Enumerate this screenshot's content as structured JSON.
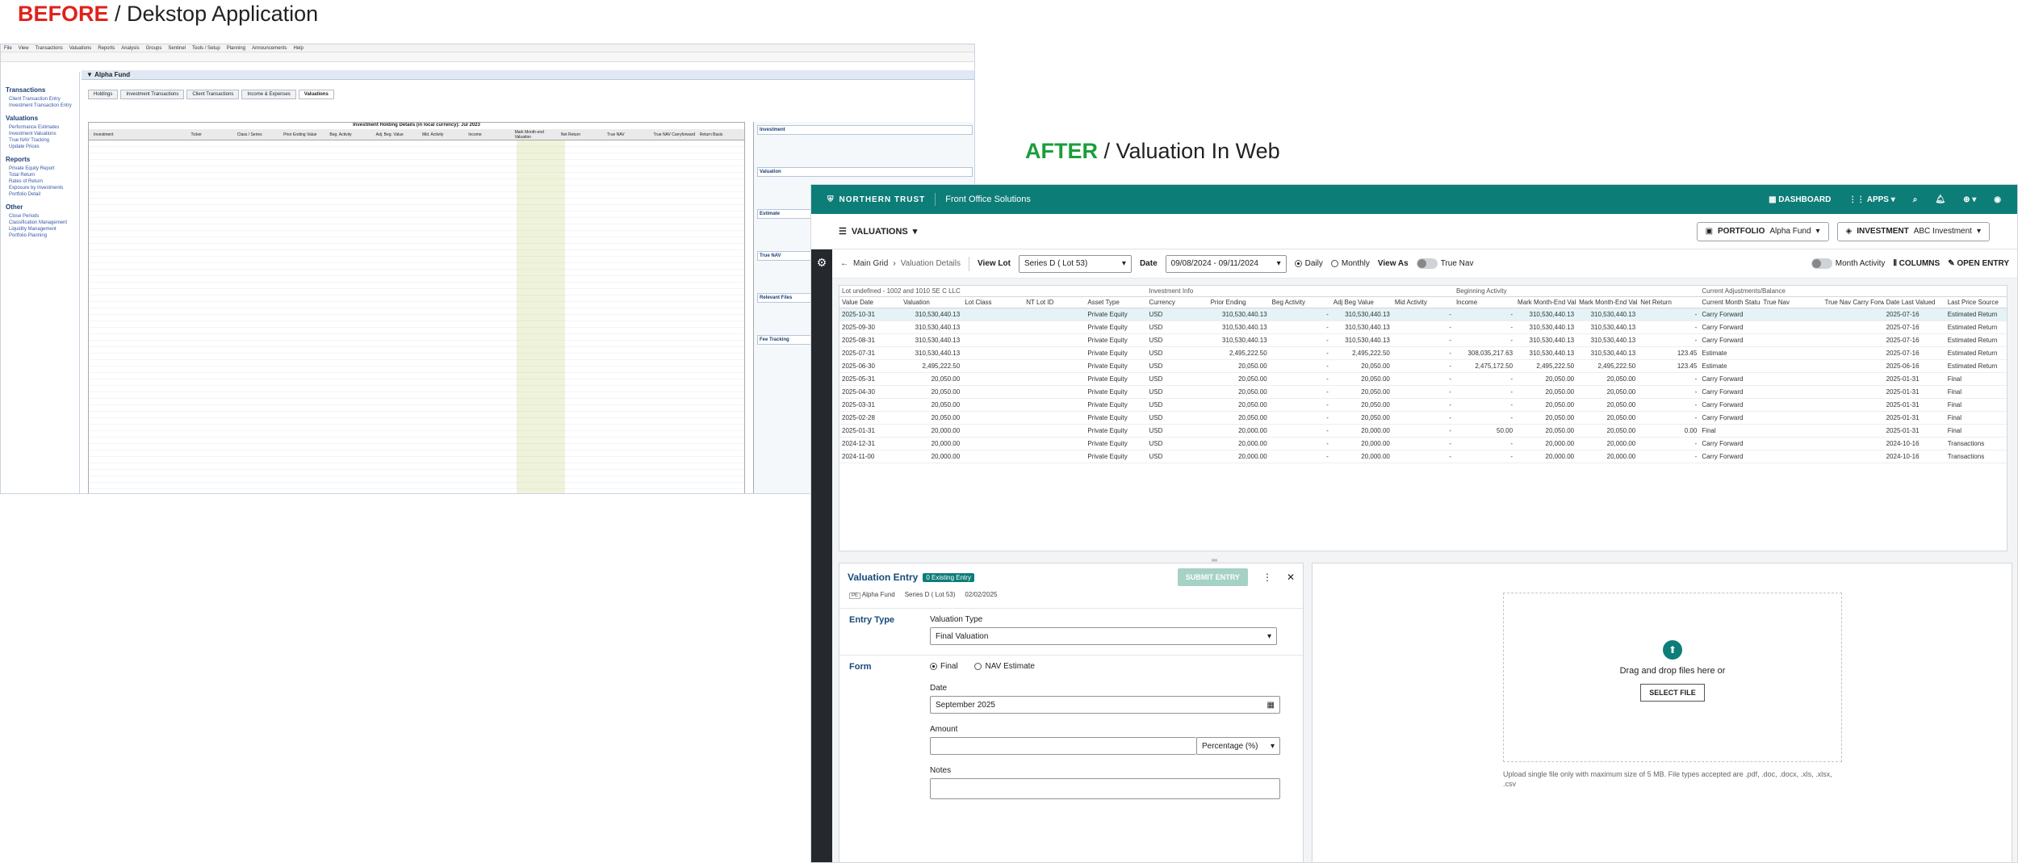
{
  "before": {
    "tag": "BEFORE",
    "label": "/ Dekstop Application",
    "desktop": {
      "menu": [
        "File",
        "View",
        "Transactions",
        "Valuations",
        "Reports",
        "Analysis",
        "Groups",
        "Sentinel",
        "Tools / Setup",
        "Planning",
        "Announcements",
        "Help"
      ],
      "fund_title": "Alpha Fund",
      "tabs": [
        "Holdings",
        "Investment Transactions",
        "Client Transactions",
        "Income & Expenses",
        "Valuations"
      ],
      "grid_title": "Investment Holding Details (in local currency): Jul 2023",
      "grid_cols": [
        "Investment",
        "Ticker",
        "Class / Series",
        "Prior Ending Value",
        "Beg. Activity",
        "Adj. Beg. Value",
        "Mid. Activity",
        "Income",
        "Mark Month-end Valuation",
        "Net Return",
        "True NAV",
        "True NAV Carryforward",
        "Return Basis"
      ],
      "sidebar": [
        {
          "head": "Transactions",
          "items": [
            "Client Transaction Entry",
            "Investment Transaction Entry"
          ]
        },
        {
          "head": "Valuations",
          "items": [
            "Performance Estimates",
            "Investment Valuations",
            "True NAV Tracking",
            "Update Prices"
          ]
        },
        {
          "head": "Reports",
          "items": [
            "Private Equity Report",
            "Total Return",
            "Rates of Return",
            "Exposure by Investments",
            "Portfolio Detail"
          ]
        },
        {
          "head": "Other",
          "items": [
            "Close Periods",
            "Classification Management",
            "Liquidity Management",
            "Portfolio Planning"
          ]
        }
      ],
      "right_panel": [
        "Investment",
        "Valuation",
        "Estimate",
        "True NAV",
        "Relevant Files",
        "Fee Tracking"
      ]
    }
  },
  "after": {
    "tag": "AFTER",
    "label": "/ Valuation In Web"
  },
  "topnav": {
    "brand": "NORTHERN TRUST",
    "product": "Front Office Solutions",
    "dashboard": "DASHBOARD",
    "apps": "APPS"
  },
  "secbar": {
    "module": "VALUATIONS",
    "portfolio_label": "PORTFOLIO",
    "portfolio_value": "Alpha Fund",
    "investment_label": "INVESTMENT",
    "investment_value": "ABC Investment"
  },
  "toolbar": {
    "crumb_root": "Main Grid",
    "crumb_current": "Valuation Details",
    "view_lot_label": "View Lot",
    "view_lot_value": "Series D  ( Lot 53)",
    "date_label": "Date",
    "date_value": "09/08/2024 - 09/11/2024",
    "daily": "Daily",
    "monthly": "Monthly",
    "view_as": "View As",
    "true_nav": "True Nav",
    "month_activity": "Month Activity",
    "columns": "COLUMNS",
    "open_entry": "OPEN ENTRY"
  },
  "table": {
    "groups": [
      "Lot undefined - 1002 and 1010 SE C LLC",
      "Investment Info",
      "Beginning Activity",
      "Current Adjustments/Balance"
    ],
    "headers": [
      "Value Date",
      "Valuation",
      "Lot Class",
      "NT Lot ID",
      "Asset Type",
      "Currency",
      "Prior Ending",
      "Beg Activity",
      "Adj Beg Value",
      "Mid Activity",
      "Income",
      "Mark Month-End Valuation",
      "Mark Month-End Valuation Base",
      "Net Return",
      "Current Month Status",
      "True Nav",
      "True Nav Carry Forward",
      "Date Last Valued",
      "Last Price Source"
    ],
    "rows": [
      [
        "2025-10-31",
        "310,530,440.13",
        "Private Equity",
        "USD",
        "310,530,440.13",
        "-",
        "310,530,440.13",
        "-",
        "-",
        "310,530,440.13",
        "310,530,440.13",
        "-",
        "Carry Forward",
        "2025-07-16",
        "Estimated Return"
      ],
      [
        "2025-09-30",
        "310,530,440.13",
        "Private Equity",
        "USD",
        "310,530,440.13",
        "-",
        "310,530,440.13",
        "-",
        "-",
        "310,530,440.13",
        "310,530,440.13",
        "-",
        "Carry Forward",
        "2025-07-16",
        "Estimated Return"
      ],
      [
        "2025-08-31",
        "310,530,440.13",
        "Private Equity",
        "USD",
        "310,530,440.13",
        "-",
        "310,530,440.13",
        "-",
        "-",
        "310,530,440.13",
        "310,530,440.13",
        "-",
        "Carry Forward",
        "2025-07-16",
        "Estimated Return"
      ],
      [
        "2025-07-31",
        "310,530,440.13",
        "Private Equity",
        "USD",
        "2,495,222.50",
        "-",
        "2,495,222.50",
        "-",
        "308,035,217.63",
        "310,530,440.13",
        "310,530,440.13",
        "123.45",
        "Estimate",
        "2025-07-16",
        "Estimated Return"
      ],
      [
        "2025-06-30",
        "2,495,222.50",
        "Private Equity",
        "USD",
        "20,050.00",
        "-",
        "20,050.00",
        "-",
        "2,475,172.50",
        "2,495,222.50",
        "2,495,222.50",
        "123.45",
        "Estimate",
        "2025-06-16",
        "Estimated Return"
      ],
      [
        "2025-05-31",
        "20,050.00",
        "Private Equity",
        "USD",
        "20,050.00",
        "-",
        "20,050.00",
        "-",
        "-",
        "20,050.00",
        "20,050.00",
        "-",
        "Carry Forward",
        "2025-01-31",
        "Final"
      ],
      [
        "2025-04-30",
        "20,050.00",
        "Private Equity",
        "USD",
        "20,050.00",
        "-",
        "20,050.00",
        "-",
        "-",
        "20,050.00",
        "20,050.00",
        "-",
        "Carry Forward",
        "2025-01-31",
        "Final"
      ],
      [
        "2025-03-31",
        "20,050.00",
        "Private Equity",
        "USD",
        "20,050.00",
        "-",
        "20,050.00",
        "-",
        "-",
        "20,050.00",
        "20,050.00",
        "-",
        "Carry Forward",
        "2025-01-31",
        "Final"
      ],
      [
        "2025-02-28",
        "20,050.00",
        "Private Equity",
        "USD",
        "20,050.00",
        "-",
        "20,050.00",
        "-",
        "-",
        "20,050.00",
        "20,050.00",
        "-",
        "Carry Forward",
        "2025-01-31",
        "Final"
      ],
      [
        "2025-01-31",
        "20,000.00",
        "Private Equity",
        "USD",
        "20,000.00",
        "-",
        "20,000.00",
        "-",
        "50.00",
        "20,050.00",
        "20,050.00",
        "0.00",
        "Final",
        "2025-01-31",
        "Final"
      ],
      [
        "2024-12-31",
        "20,000.00",
        "Private Equity",
        "USD",
        "20,000.00",
        "-",
        "20,000.00",
        "-",
        "-",
        "20,000.00",
        "20,000.00",
        "-",
        "Carry Forward",
        "2024-10-16",
        "Transactions"
      ],
      [
        "2024-11-00",
        "20,000.00",
        "Private Equity",
        "USD",
        "20,000.00",
        "-",
        "20,000.00",
        "-",
        "-",
        "20,000.00",
        "20,000.00",
        "-",
        "Carry Forward",
        "2024-10-16",
        "Transactions"
      ]
    ]
  },
  "entry": {
    "title": "Valuation Entry",
    "badge": "0 Existing Entry",
    "submit": "SUBMIT ENTRY",
    "meta_tag": "PE",
    "meta_fund": "Alpha Fund",
    "meta_lot": "Series D  ( Lot 53)",
    "meta_date": "02/02/2025",
    "entry_type_label": "Entry Type",
    "valuation_type_label": "Valuation Type",
    "valuation_type_value": "Final Valuation",
    "form_label": "Form",
    "final": "Final",
    "nav_estimate": "NAV Estimate",
    "date_label": "Date",
    "date_value": "September 2025",
    "amount_label": "Amount",
    "amount_unit": "Percentage (%)",
    "notes_label": "Notes"
  },
  "upload": {
    "drag_text": "Drag and drop files here or",
    "button": "SELECT FILE",
    "note": "Upload single file only with maximum size of 5 MB. File types accepted are .pdf, .doc, .docx, .xls, .xlsx, .csv"
  },
  "colors": {
    "teal": "#0d7d78",
    "before_red": "#e0221c",
    "after_green": "#1b9e3b"
  }
}
